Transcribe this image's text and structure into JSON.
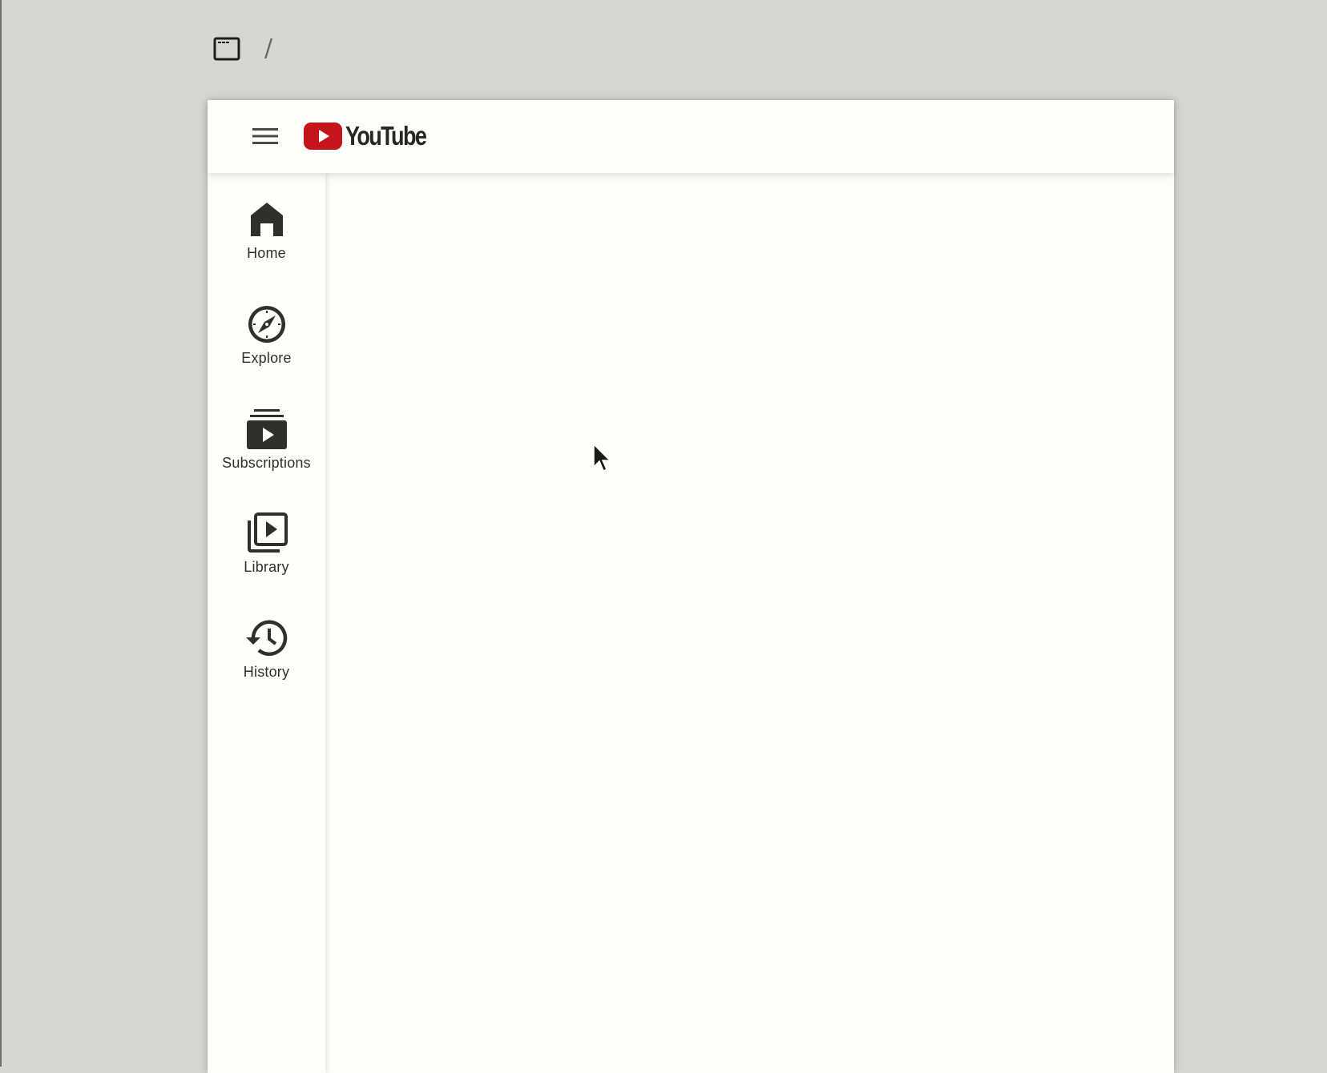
{
  "breadcrumb": {
    "window_icon": "window-icon",
    "separator": "/"
  },
  "header": {
    "menu_icon": "hamburger-menu-icon",
    "logo_text": "YouTube",
    "logo_color": "#c4141c"
  },
  "sidebar": {
    "items": [
      {
        "label": "Home",
        "icon": "home-icon"
      },
      {
        "label": "Explore",
        "icon": "compass-icon"
      },
      {
        "label": "Subscriptions",
        "icon": "subscriptions-icon"
      },
      {
        "label": "Library",
        "icon": "library-icon"
      },
      {
        "label": "History",
        "icon": "history-icon"
      }
    ]
  },
  "colors": {
    "background": "#d6d6d3",
    "surface": "#fdfdfa",
    "icon": "#2f2f2d",
    "brand_red": "#c4141c"
  }
}
